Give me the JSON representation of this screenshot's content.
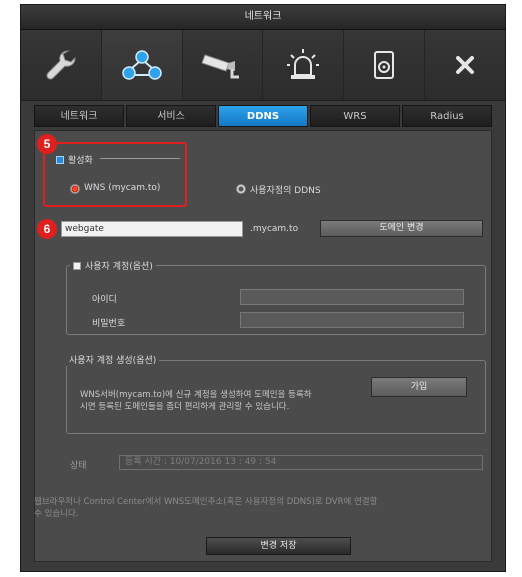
{
  "title": "네트워크",
  "toolbar": {
    "items": [
      {
        "icon": "wrench-icon"
      },
      {
        "icon": "network-icon"
      },
      {
        "icon": "camera-icon"
      },
      {
        "icon": "alarm-icon"
      },
      {
        "icon": "disk-icon"
      },
      {
        "icon": "close-icon"
      }
    ]
  },
  "tabs": [
    {
      "label": "네트워크"
    },
    {
      "label": "서비스"
    },
    {
      "label": "DDNS"
    },
    {
      "label": "WRS"
    },
    {
      "label": "Radius"
    }
  ],
  "ddns": {
    "enable_label": "활성화",
    "radio_wns": "WNS (mycam.to)",
    "radio_custom": "사용자정의 DDNS",
    "domain_value": "webgate",
    "domain_suffix": ".mycam.to",
    "change_domain_button": "도메인 변경"
  },
  "user_account": {
    "legend": "사용자 계정(옵션)",
    "id_label": "아이디",
    "password_label": "비밀번호"
  },
  "create_account": {
    "legend": "사용자 계정 생성(옵션)",
    "description_line1": "WNS서버(mycam.to)에 신규 계정을 생성하여 도메인을 등록하",
    "description_line2": "시면 등록된 도메인들을 좀더 편리하게 관리할 수 있습니다.",
    "join_button": "가입"
  },
  "status": {
    "label": "상태",
    "value": "등록 시간 : 10/07/2016  13 : 49 : 54"
  },
  "note": {
    "line1": "웹브라우저나 Control Center에서 WNS도메인주소(혹은 사용자정의 DDNS)로 DVR에 연결할",
    "line2": "수 있습니다."
  },
  "apply_button": "변경 저장",
  "annotations": {
    "badge5": "5",
    "badge6": "6"
  },
  "colors": {
    "accent": "#1e8ad8",
    "highlight": "#e0201f",
    "window": "#3a3a3a"
  }
}
